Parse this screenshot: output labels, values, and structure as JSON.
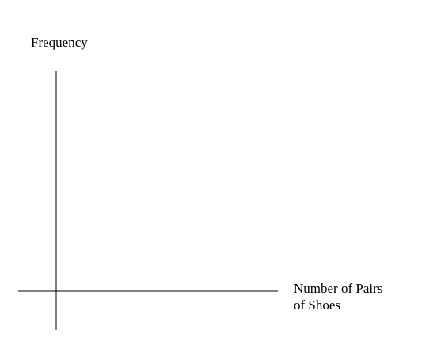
{
  "chart_data": {
    "type": "bar",
    "title": "",
    "ylabel": "Frequency",
    "xlabel_lines": [
      "Number of Pairs",
      "of Shoes"
    ],
    "categories": [],
    "values": [],
    "grid": false
  }
}
